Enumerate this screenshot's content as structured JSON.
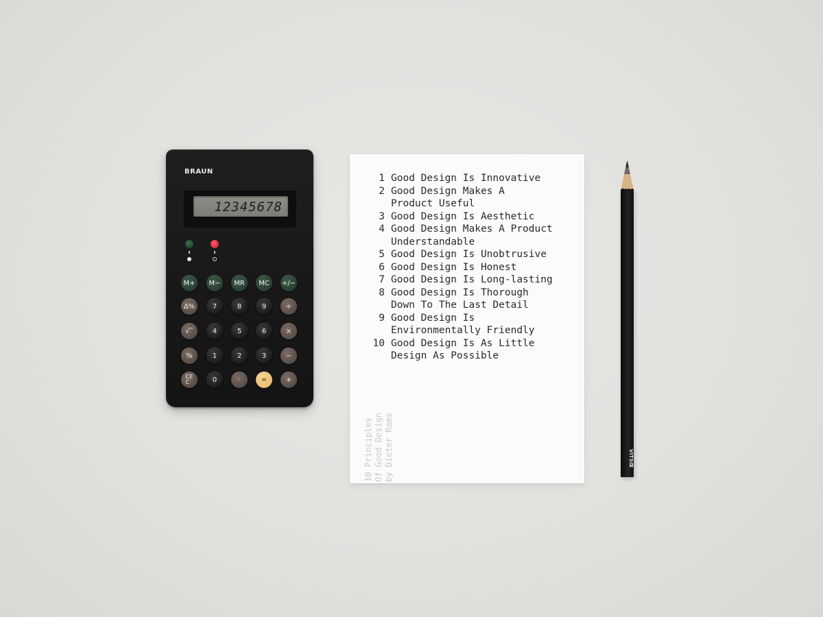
{
  "calculator": {
    "brand": "BRAUN",
    "display": "12345678",
    "keys": [
      {
        "label": "M+",
        "color": "green"
      },
      {
        "label": "M−",
        "color": "green"
      },
      {
        "label": "MR",
        "color": "green"
      },
      {
        "label": "MC",
        "color": "green"
      },
      {
        "label": "+/−",
        "color": "green"
      },
      {
        "label": "Δ%",
        "color": "brown"
      },
      {
        "label": "7",
        "color": "black"
      },
      {
        "label": "8",
        "color": "black"
      },
      {
        "label": "9",
        "color": "black"
      },
      {
        "label": "÷",
        "color": "brown"
      },
      {
        "label": "√‾",
        "color": "brown"
      },
      {
        "label": "4",
        "color": "black"
      },
      {
        "label": "5",
        "color": "black"
      },
      {
        "label": "6",
        "color": "black"
      },
      {
        "label": "×",
        "color": "brown"
      },
      {
        "label": "%",
        "color": "brown"
      },
      {
        "label": "1",
        "color": "black"
      },
      {
        "label": "2",
        "color": "black"
      },
      {
        "label": "3",
        "color": "black"
      },
      {
        "label": "−",
        "color": "brown"
      },
      {
        "label": "CE\nC",
        "color": "brown"
      },
      {
        "label": "0",
        "color": "black"
      },
      {
        "label": "·",
        "color": "brown"
      },
      {
        "label": "=",
        "color": "yellow"
      },
      {
        "label": "+",
        "color": "brown"
      }
    ]
  },
  "card": {
    "principles": [
      {
        "num": "1",
        "text": "Good Design Is Innovative"
      },
      {
        "num": "2",
        "text": "Good Design Makes A\nProduct Useful"
      },
      {
        "num": "3",
        "text": "Good Design Is Aesthetic"
      },
      {
        "num": "4",
        "text": "Good Design Makes A Product\nUnderstandable"
      },
      {
        "num": "5",
        "text": "Good Design Is Unobtrusive"
      },
      {
        "num": "6",
        "text": "Good Design Is Honest"
      },
      {
        "num": "7",
        "text": "Good Design Is Long-lasting"
      },
      {
        "num": "8",
        "text": "Good Design Is Thorough\nDown To The Last Detail"
      },
      {
        "num": "9",
        "text": "Good Design Is\nEnvironmentally Friendly"
      },
      {
        "num": "10",
        "text": "Good Design Is As Little\nDesign As Possible"
      }
    ],
    "side_title": [
      "10 Principles",
      "Of Good Design",
      "by Dieter Rams"
    ]
  },
  "pencil": {
    "brand": "VITSŒ"
  },
  "colors": {
    "background": "#e5e3e0",
    "calculator_body": "#1b1b1b",
    "key_green": "#2c4535",
    "key_brown": "#5e514a",
    "key_yellow": "#ebc37a",
    "led_red": "#e8233b",
    "card": "#fbfbfb",
    "pencil": "#151515"
  }
}
